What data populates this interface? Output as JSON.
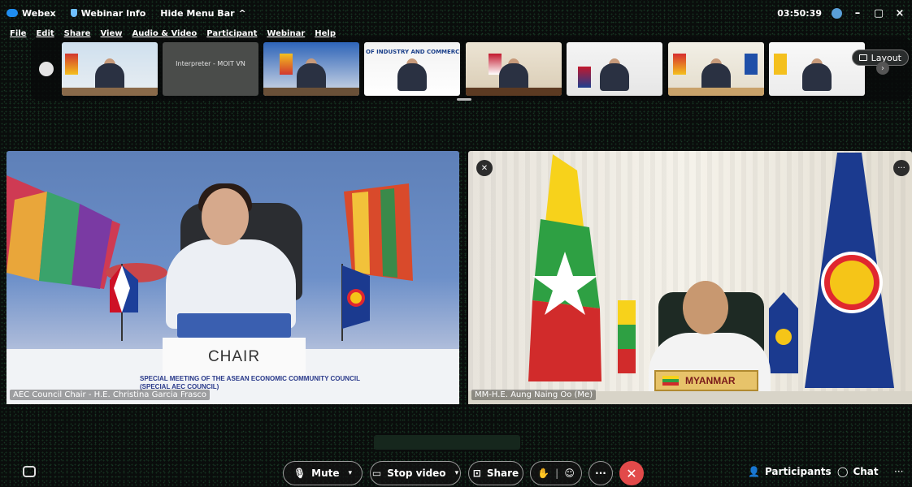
{
  "titlebar": {
    "app_name": "Webex",
    "webinar_info": "Webinar Info",
    "hide_menu": "Hide Menu Bar",
    "hide_menu_chevron": "^",
    "timer": "03:50:39",
    "minimize": "–",
    "restore": "▢",
    "close": "×"
  },
  "menubar": {
    "items": [
      "File",
      "Edit",
      "Share",
      "View",
      "Audio & Video",
      "Participant",
      "Webinar",
      "Help"
    ]
  },
  "filmstrip": {
    "interpreter_label": "Interpreter - MOIT VN",
    "banner_text": "OF INDUSTRY AND COMMERCE",
    "layout_label": "Layout",
    "next_arrow": "›"
  },
  "left_panel": {
    "placard": "CHAIR",
    "meeting_title_1": "SPECIAL MEETING OF THE ASEAN ECONOMIC COMMUNITY COUNCIL",
    "meeting_title_2": "(SPECIAL AEC COUNCIL)",
    "name_tag": "AEC Council Chair - H.E. Christina Garcia Frasco"
  },
  "right_panel": {
    "placard": "MYANMAR",
    "name_tag": "MM-H.E. Aung Naing Oo (Me)"
  },
  "controls": {
    "mute": "Mute",
    "stop_video": "Stop video",
    "share": "Share",
    "more": "···",
    "end": "✕",
    "participants": "Participants",
    "chat": "Chat",
    "overflow": "···"
  },
  "colors": {
    "background": "#0a0d0c",
    "end_button": "#e24a4a",
    "accent_blue": "#1f8ef1"
  }
}
